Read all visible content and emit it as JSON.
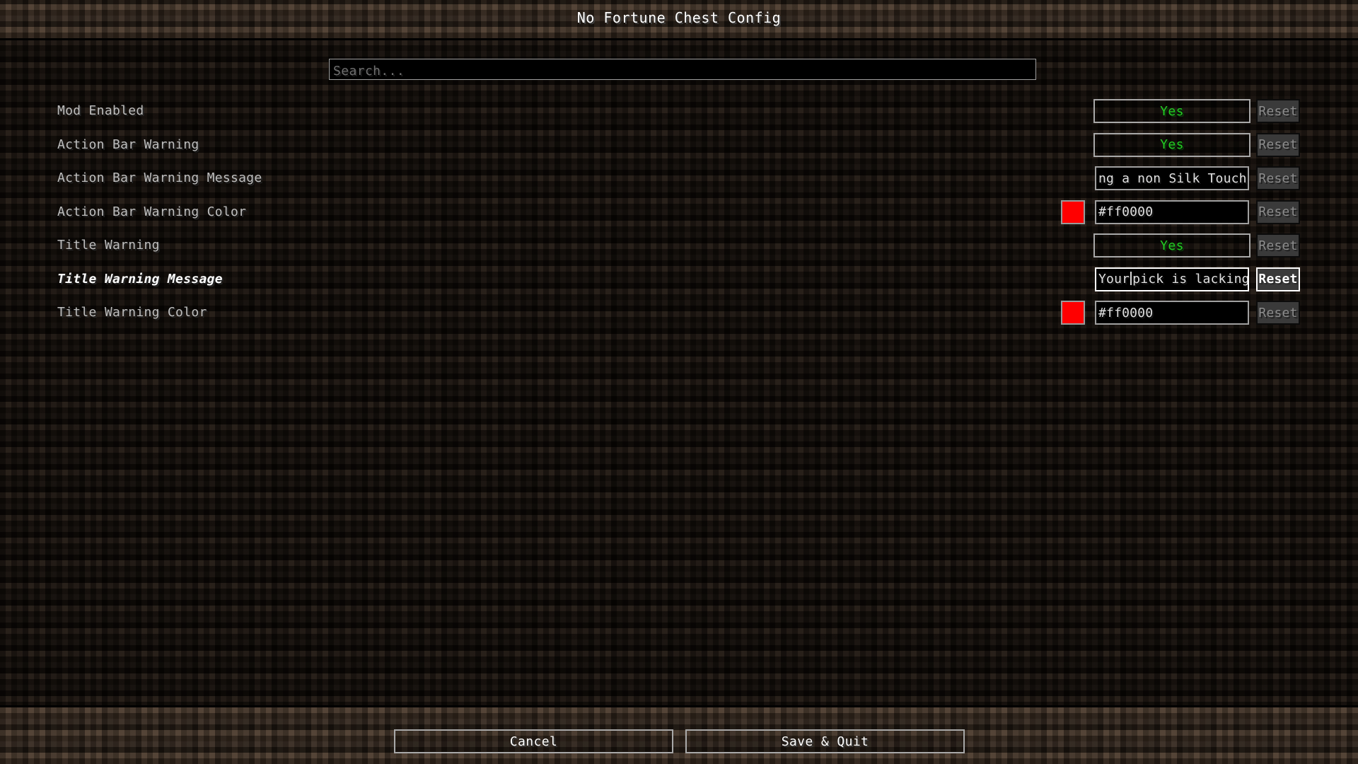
{
  "header": {
    "title": "No Fortune Chest Config"
  },
  "search": {
    "placeholder": "Search...",
    "value": ""
  },
  "colors": {
    "accent_red": "#ff0000",
    "toggle_green": "#22cc22",
    "label_grey": "#bfbfbf",
    "modified_white": "#ffffff",
    "border_grey": "#a8a8a8"
  },
  "options": [
    {
      "label": "Mod Enabled",
      "modified": false,
      "control": "toggle",
      "value": "Yes",
      "reset_label": "Reset",
      "reset_enabled": false
    },
    {
      "label": "Action Bar Warning",
      "modified": false,
      "control": "toggle",
      "value": "Yes",
      "reset_label": "Reset",
      "reset_enabled": false
    },
    {
      "label": "Action Bar Warning Message",
      "modified": false,
      "control": "text",
      "value": "ng a non Silk Touch ",
      "caret": "block-end",
      "focused": false,
      "reset_label": "Reset",
      "reset_enabled": false
    },
    {
      "label": "Action Bar Warning Color",
      "modified": false,
      "control": "color",
      "value": "#ff0000",
      "swatch": "#ff0000",
      "focused": false,
      "reset_label": "Reset",
      "reset_enabled": false
    },
    {
      "label": "Title Warning",
      "modified": false,
      "control": "toggle",
      "value": "Yes",
      "reset_label": "Reset",
      "reset_enabled": false
    },
    {
      "label": "Title Warning Message",
      "modified": true,
      "control": "text",
      "value_before_caret": "Your",
      "value_after_caret": "pick is lacking.",
      "caret": "inline",
      "focused": true,
      "reset_label": "Reset",
      "reset_enabled": true
    },
    {
      "label": "Title Warning Color",
      "modified": false,
      "control": "color",
      "value": "#ff0000",
      "swatch": "#ff0000",
      "focused": false,
      "reset_label": "Reset",
      "reset_enabled": false
    }
  ],
  "footer": {
    "cancel_label": "Cancel",
    "save_quit_label": "Save & Quit"
  }
}
